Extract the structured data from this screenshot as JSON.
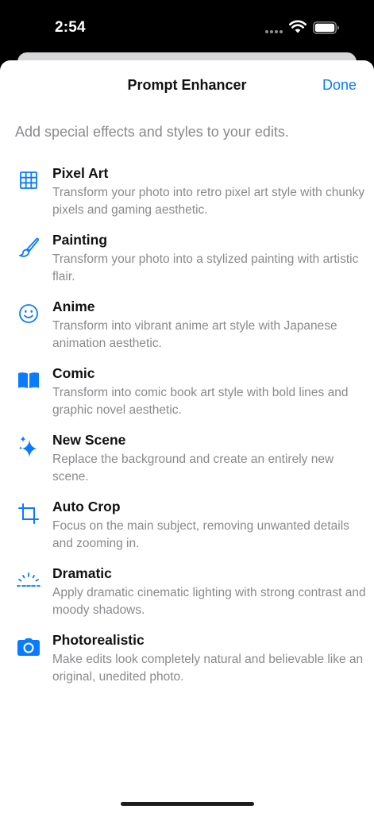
{
  "status_bar": {
    "time": "2:54"
  },
  "sheet": {
    "title": "Prompt Enhancer",
    "done_label": "Done",
    "subtitle": "Add special effects and styles to your edits."
  },
  "accent_color": "#0a7aff",
  "effects": [
    {
      "title": "Pixel Art",
      "description": "Transform your photo into retro pixel art style with chunky pixels and gaming aesthetic.",
      "icon": "grid-icon"
    },
    {
      "title": "Painting",
      "description": "Transform your photo into a stylized painting with artistic flair.",
      "icon": "paintbrush-icon"
    },
    {
      "title": "Anime",
      "description": "Transform into vibrant anime art style with Japanese animation aesthetic.",
      "icon": "smiley-icon"
    },
    {
      "title": "Comic",
      "description": "Transform into comic book art style with bold lines and graphic novel aesthetic.",
      "icon": "book-icon"
    },
    {
      "title": "New Scene",
      "description": "Replace the background and create an entirely new scene.",
      "icon": "sparkles-icon"
    },
    {
      "title": "Auto Crop",
      "description": "Focus on the main subject, removing unwanted details and zooming in.",
      "icon": "crop-icon"
    },
    {
      "title": "Dramatic",
      "description": "Apply dramatic cinematic lighting with strong contrast and moody shadows.",
      "icon": "sunrise-icon"
    },
    {
      "title": "Photorealistic",
      "description": "Make edits look completely natural and believable like an original, unedited photo.",
      "icon": "camera-icon"
    }
  ]
}
